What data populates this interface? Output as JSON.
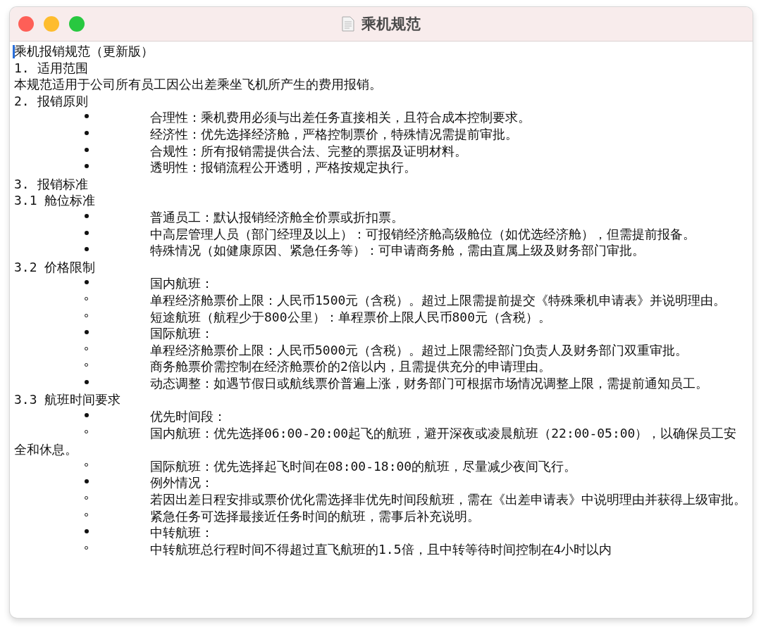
{
  "window": {
    "title": "乘机规范"
  },
  "lines": [
    {
      "kind": "text",
      "text": "乘机报销规范（更新版）"
    },
    {
      "kind": "text",
      "text": "1. 适用范围"
    },
    {
      "kind": "text",
      "text": "本规范适用于公司所有员工因公出差乘坐飞机所产生的费用报销。"
    },
    {
      "kind": "text",
      "text": "2. 报销原则"
    },
    {
      "kind": "bullet",
      "text": "合理性：乘机费用必须与出差任务直接相关，且符合成本控制要求。"
    },
    {
      "kind": "bullet",
      "text": "经济性：优先选择经济舱，严格控制票价，特殊情况需提前审批。"
    },
    {
      "kind": "bullet",
      "text": "合规性：所有报销需提供合法、完整的票据及证明材料。"
    },
    {
      "kind": "bullet",
      "text": "透明性：报销流程公开透明，严格按规定执行。"
    },
    {
      "kind": "text",
      "text": "3. 报销标准"
    },
    {
      "kind": "text",
      "text": "3.1 舱位标准"
    },
    {
      "kind": "bullet",
      "text": "普通员工：默认报销经济舱全价票或折扣票。"
    },
    {
      "kind": "bullet",
      "text": "中高层管理人员（部门经理及以上）：可报销经济舱高级舱位（如优选经济舱），但需提前报备。"
    },
    {
      "kind": "bullet",
      "text": "特殊情况（如健康原因、紧急任务等）：可申请商务舱，需由直属上级及财务部门审批。"
    },
    {
      "kind": "text",
      "text": "3.2 价格限制"
    },
    {
      "kind": "bullet",
      "text": "国内航班："
    },
    {
      "kind": "circle",
      "text": "单程经济舱票价上限：人民币1500元（含税）。超过上限需提前提交《特殊乘机申请表》并说明理由。"
    },
    {
      "kind": "circle",
      "text": "短途航班（航程少于800公里）：单程票价上限人民币800元（含税）。"
    },
    {
      "kind": "bullet",
      "text": "国际航班："
    },
    {
      "kind": "circle",
      "text": "单程经济舱票价上限：人民币5000元（含税）。超过上限需经部门负责人及财务部门双重审批。"
    },
    {
      "kind": "circle",
      "text": "商务舱票价需控制在经济舱票价的2倍以内，且需提供充分的申请理由。"
    },
    {
      "kind": "bullet",
      "text": "动态调整：如遇节假日或航线票价普遍上涨，财务部门可根据市场情况调整上限，需提前通知员工。"
    },
    {
      "kind": "text",
      "text": "3.3 航班时间要求"
    },
    {
      "kind": "bullet",
      "text": "优先时间段："
    },
    {
      "kind": "circle",
      "text": "国内航班：优先选择06:00-20:00起飞的航班，避开深夜或凌晨航班（22:00-05:00），以确保员工安全和休息。"
    },
    {
      "kind": "circle",
      "text": "国际航班：优先选择起飞时间在08:00-18:00的航班，尽量减少夜间飞行。"
    },
    {
      "kind": "bullet",
      "text": "例外情况："
    },
    {
      "kind": "circle",
      "text": "若因出差日程安排或票价优化需选择非优先时间段航班，需在《出差申请表》中说明理由并获得上级审批。"
    },
    {
      "kind": "circle",
      "text": "紧急任务可选择最接近任务时间的航班，需事后补充说明。"
    },
    {
      "kind": "bullet",
      "text": "中转航班："
    },
    {
      "kind": "circle",
      "text": "中转航班总行程时间不得超过直飞航班的1.5倍，且中转等待时间控制在4小时以内"
    }
  ]
}
